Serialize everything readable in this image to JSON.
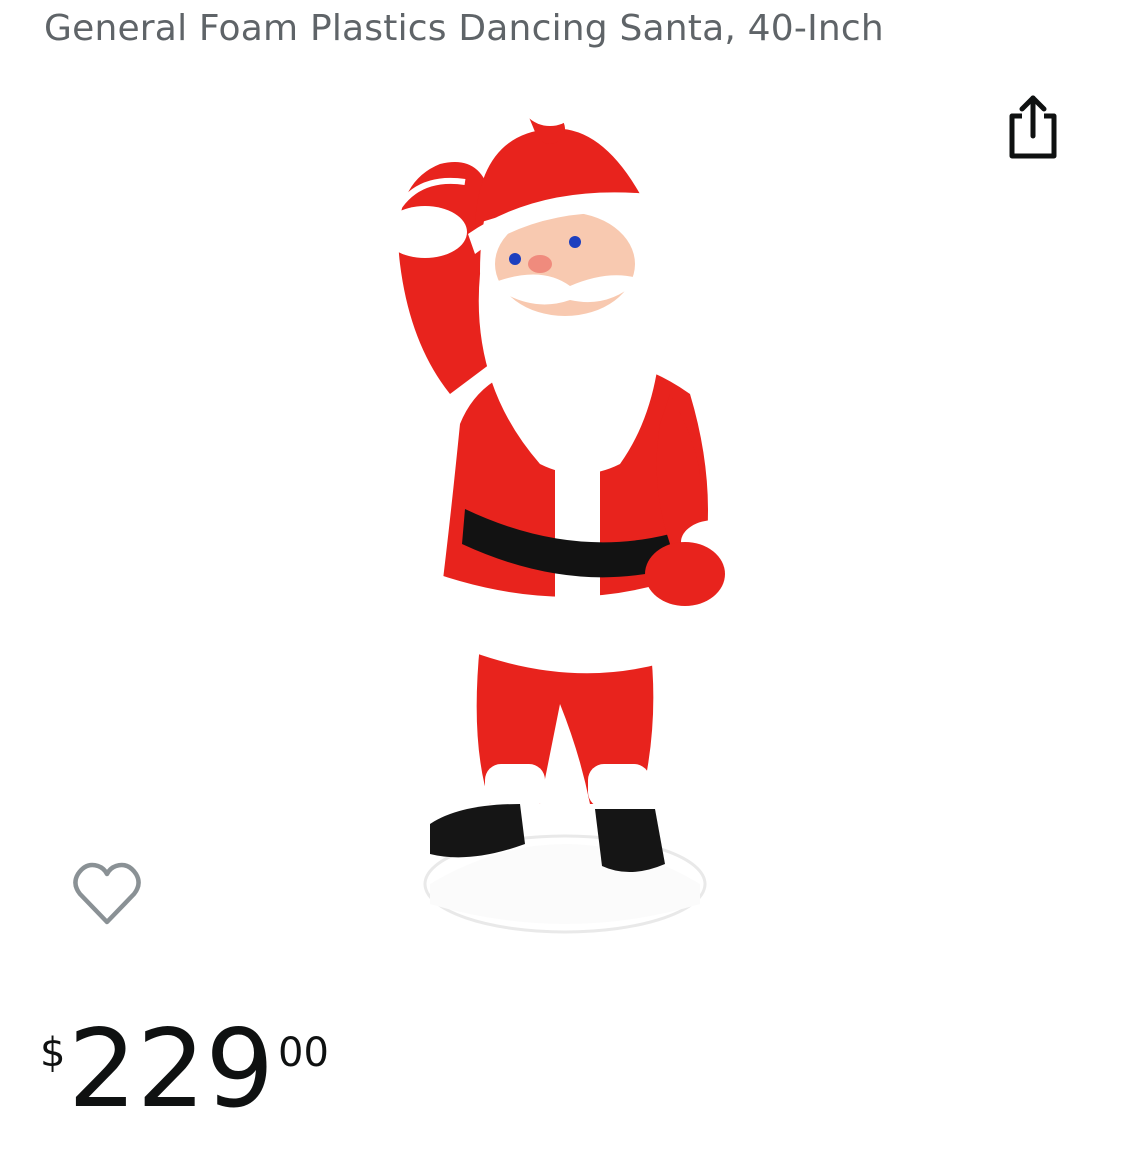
{
  "product": {
    "title": "General Foam Plastics Dancing Santa, 40-Inch",
    "image": "dancing-santa-figure",
    "price": {
      "symbol": "$",
      "whole": "229",
      "fraction": "00"
    }
  },
  "actions": {
    "share_icon": "share-icon",
    "wishlist_icon": "heart-outline-icon"
  },
  "colors": {
    "title_text": "#5f6468",
    "price_text": "#0f1111",
    "santa_red": "#e21b1b",
    "heart_outline": "#8a9195"
  }
}
